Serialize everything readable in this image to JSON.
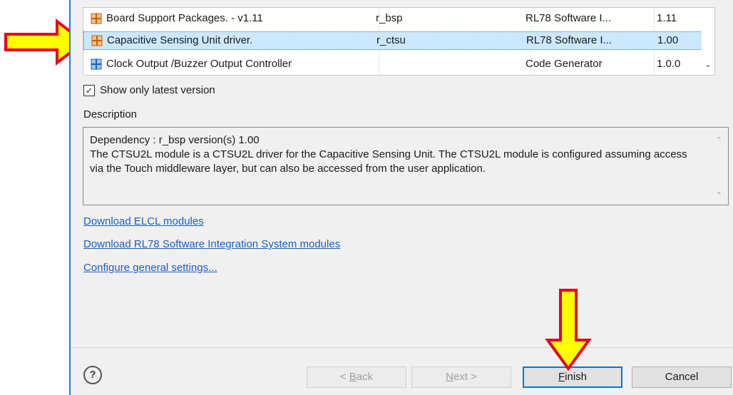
{
  "table": {
    "rows": [
      {
        "name": "Board Support Packages. - v1.11",
        "id": "r_bsp",
        "type": "RL78 Software I...",
        "version": "1.11",
        "icon": "grid-orange-icon"
      },
      {
        "name": "Capacitive Sensing Unit driver.",
        "id": "r_ctsu",
        "type": "RL78 Software I...",
        "version": "1.00",
        "icon": "grid-orange-icon",
        "selected": true
      },
      {
        "name": "Clock Output /Buzzer Output Controller",
        "id": "",
        "type": "Code Generator",
        "version": "1.0.0",
        "icon": "grid-blue-icon"
      }
    ]
  },
  "checkbox": {
    "label": "Show only latest version",
    "checked": true,
    "mark": "✓"
  },
  "description": {
    "label": "Description",
    "dependency": "Dependency : r_bsp version(s) 1.00",
    "text": "The CTSU2L module is a CTSU2L driver for the Capacitive Sensing Unit. The CTSU2L module is configured assuming access via the Touch middleware layer, but can also be accessed from the user application."
  },
  "links": {
    "elcl": "Download ELCL modules",
    "rl78": "Download RL78 Software Integration System modules",
    "settings": "Configure general settings..."
  },
  "buttons": {
    "help": "?",
    "back": "< Back",
    "next": "Next >",
    "finish": "Finish",
    "cancel": "Cancel"
  },
  "colors": {
    "highlight_arrow": "#ffff00",
    "arrow_border": "#e8001c",
    "selection": "#cce8ff"
  }
}
